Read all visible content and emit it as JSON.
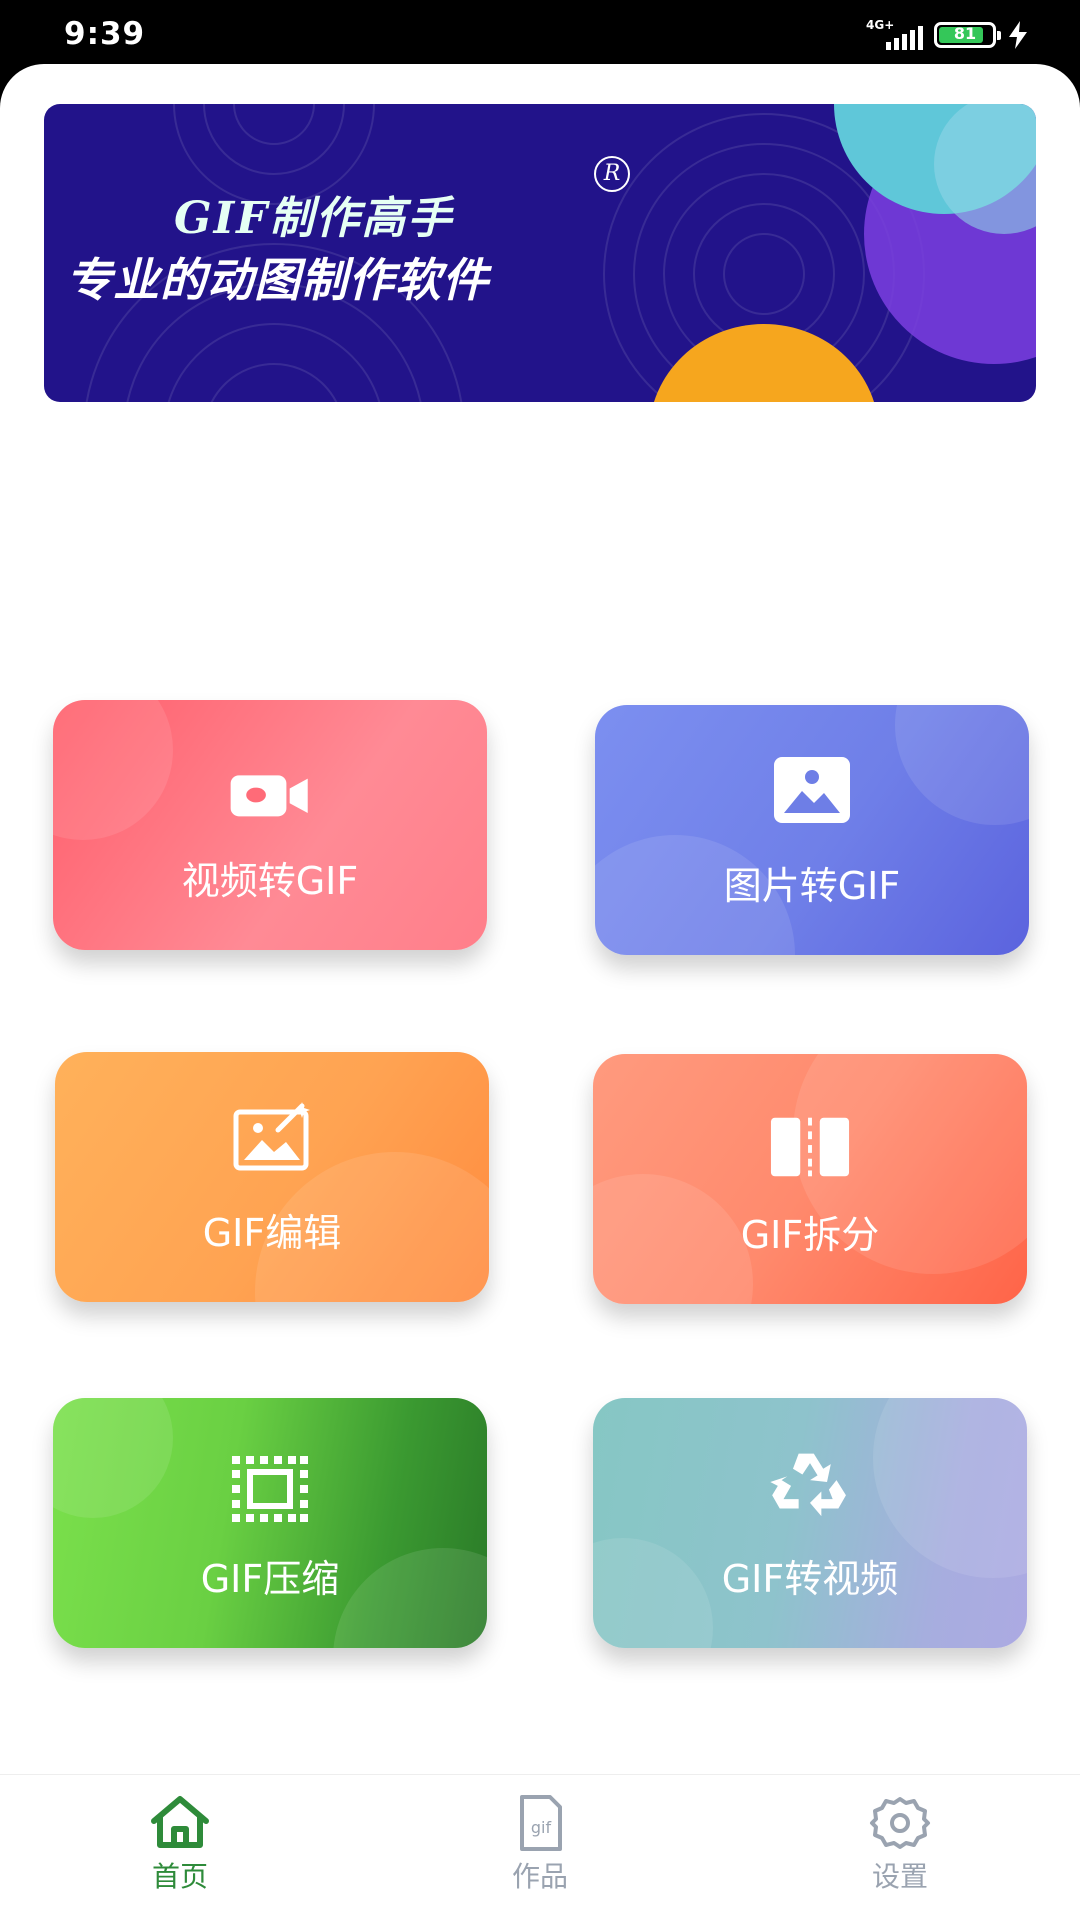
{
  "status_bar": {
    "time": "9:39",
    "network": "4G+",
    "battery": "81"
  },
  "banner": {
    "title": "GIF制作高手",
    "registered_mark": "R",
    "subtitle": "专业的动图制作软件"
  },
  "features": [
    {
      "label": "视频转GIF",
      "icon": "video-camera-icon"
    },
    {
      "label": "图片转GIF",
      "icon": "image-icon"
    },
    {
      "label": "GIF编辑",
      "icon": "magic-image-edit-icon"
    },
    {
      "label": "GIF拆分",
      "icon": "split-icon"
    },
    {
      "label": "GIF压缩",
      "icon": "compress-icon"
    },
    {
      "label": "GIF转视频",
      "icon": "recycle-convert-icon"
    }
  ],
  "tabbar": {
    "items": [
      {
        "label": "首页",
        "icon": "home-icon",
        "active": true
      },
      {
        "label": "作品",
        "icon": "gif-file-icon",
        "active": false
      },
      {
        "label": "设置",
        "icon": "gear-icon",
        "active": false
      }
    ],
    "active_color": "#2e8b3a",
    "inactive_color": "#9aa3b0"
  }
}
